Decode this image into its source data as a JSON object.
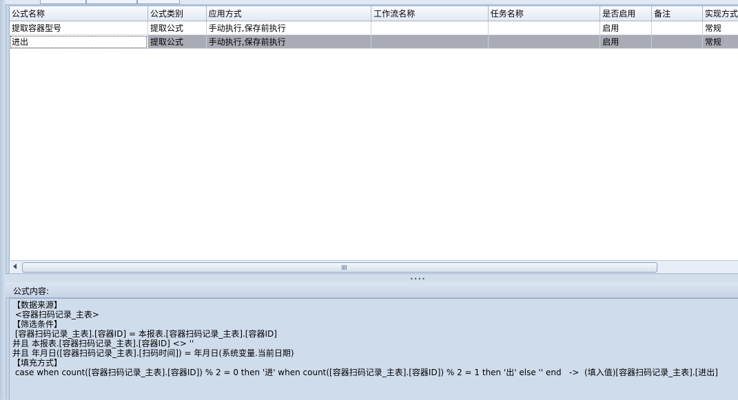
{
  "grid": {
    "columns": [
      "公式名称",
      "公式类别",
      "应用方式",
      "工作流名称",
      "任务名称",
      "是否启用",
      "备注",
      "实现方式"
    ],
    "rows": [
      [
        "提取容器型号",
        "提取公式",
        "手动执行,保存前执行",
        "",
        "",
        "启用",
        "",
        "常规"
      ],
      [
        "进出",
        "提取公式",
        "手动执行,保存前执行",
        "",
        "",
        "启用",
        "",
        "常规"
      ]
    ],
    "selected_row": 1
  },
  "panel": {
    "title": "公式内容:"
  },
  "formula": {
    "lines": [
      "【数据来源】",
      " <容器扫码记录_主表>",
      "【筛选条件】",
      " [容器扫码记录_主表].[容器ID] = 本报表.[容器扫码记录_主表].[容器ID]",
      "并且 本报表.[容器扫码记录_主表].[容器ID] <> ''",
      "并且 年月日([容器扫码记录_主表].[扫码时间]) = 年月日(系统变量.当前日期)",
      "【填充方式】",
      " case when count([容器扫码记录_主表].[容器ID]) % 2 = 0 then '进' when count([容器扫码记录_主表].[容器ID]) % 2 = 1 then '出' else '' end   ->  (填入值)[容器扫码记录_主表].[进出]"
    ]
  }
}
